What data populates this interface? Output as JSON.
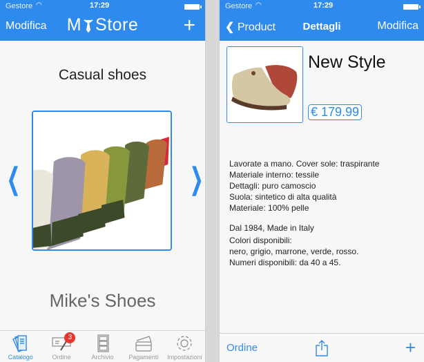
{
  "status_bar": {
    "carrier": "Gestore",
    "time": "17:29"
  },
  "left_screen": {
    "nav": {
      "left_button": "Modifica",
      "title": "My Store",
      "title_parts": [
        "M",
        "Store"
      ],
      "right_button": "+"
    },
    "category_title": "Casual shoes",
    "carousel": {
      "image": "row-of-colored-canvas-shoes",
      "prev_icon": "chevron-left-icon",
      "next_icon": "chevron-right-icon"
    },
    "brand_name": "Mike's Shoes",
    "tabs": [
      {
        "label": "Catalogo",
        "icon": "catalog-icon",
        "active": true
      },
      {
        "label": "Ordine",
        "icon": "order-icon",
        "badge": "3"
      },
      {
        "label": "Archivio",
        "icon": "archive-icon"
      },
      {
        "label": "Pagamenti",
        "icon": "payments-icon"
      },
      {
        "label": "Impostazioni",
        "icon": "settings-icon"
      }
    ]
  },
  "right_screen": {
    "nav": {
      "back_button": "Product",
      "title": "Dettagli",
      "right_button": "Modifica"
    },
    "product": {
      "name": "New Style",
      "price": "€ 179.99",
      "image": "beige-suede-shoe",
      "description_lines": [
        "Lavorate a mano. Cover sole: traspirante",
        "Materiale interno: tessile",
        "Dettagli: puro camoscio",
        "Suola: sintetico di alta qualità",
        "Materiale: 100% pelle"
      ],
      "origin": "Dal 1984, Made in Italy",
      "colors_label": "Colori disponibili:",
      "colors": "nero, grigio, marrone, verde, rosso.",
      "sizes": "Numeri disponibili: da 40 a 45."
    },
    "toolbar": {
      "order_button": "Ordine",
      "share_icon": "share-icon",
      "add_button": "+"
    }
  },
  "colors": {
    "accent": "#2f8aed",
    "badge": "#e8352d"
  }
}
